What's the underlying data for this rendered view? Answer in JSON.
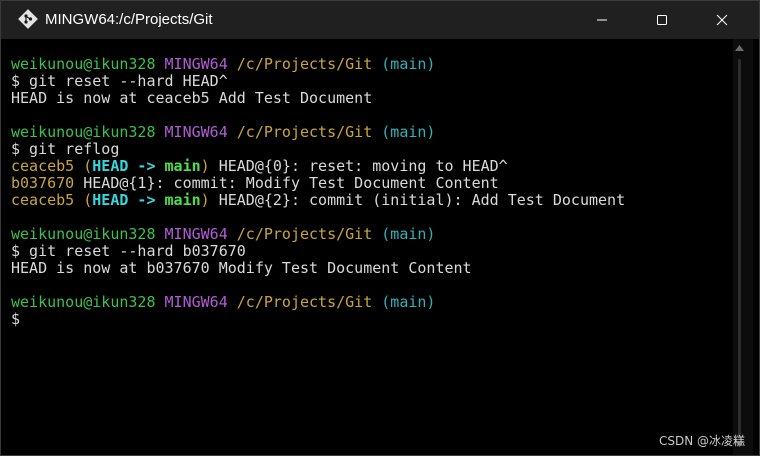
{
  "window": {
    "title": "MINGW64:/c/Projects/Git",
    "icon": "git-icon"
  },
  "prompt": {
    "user": "weikunou@ikun328",
    "system": "MINGW64",
    "path": "/c/Projects/Git",
    "branch": "(main)"
  },
  "lines": {
    "cmd1": "$ git reset --hard HEAD^",
    "out1": "HEAD is now at ceaceb5 Add Test Document",
    "cmd2": "$ git reflog",
    "reflog1_hash": "ceaceb5",
    "reflog1_open": "(",
    "reflog1_head": "HEAD",
    "reflog1_arrow": " -> ",
    "reflog1_main": "main",
    "reflog1_close": ")",
    "reflog1_msg": " HEAD@{0}: reset: moving to HEAD^",
    "reflog2_hash": "b037670",
    "reflog2_msg": " HEAD@{1}: commit: Modify Test Document Content",
    "reflog3_hash": "ceaceb5",
    "reflog3_open": "(",
    "reflog3_head": "HEAD",
    "reflog3_arrow": " -> ",
    "reflog3_main": "main",
    "reflog3_close": ")",
    "reflog3_msg": " HEAD@{2}: commit (initial): Add Test Document",
    "cmd3": "$ git reset --hard b037670",
    "out3": "HEAD is now at b037670 Modify Test Document Content",
    "final_prompt": "$"
  },
  "watermark": "CSDN @冰凌糕",
  "colors": {
    "user": "#3ac14f",
    "system": "#b35bd6",
    "path": "#c9a53a",
    "branch": "#2fb2b8",
    "head": "#37d6dc",
    "main": "#49e04a"
  }
}
